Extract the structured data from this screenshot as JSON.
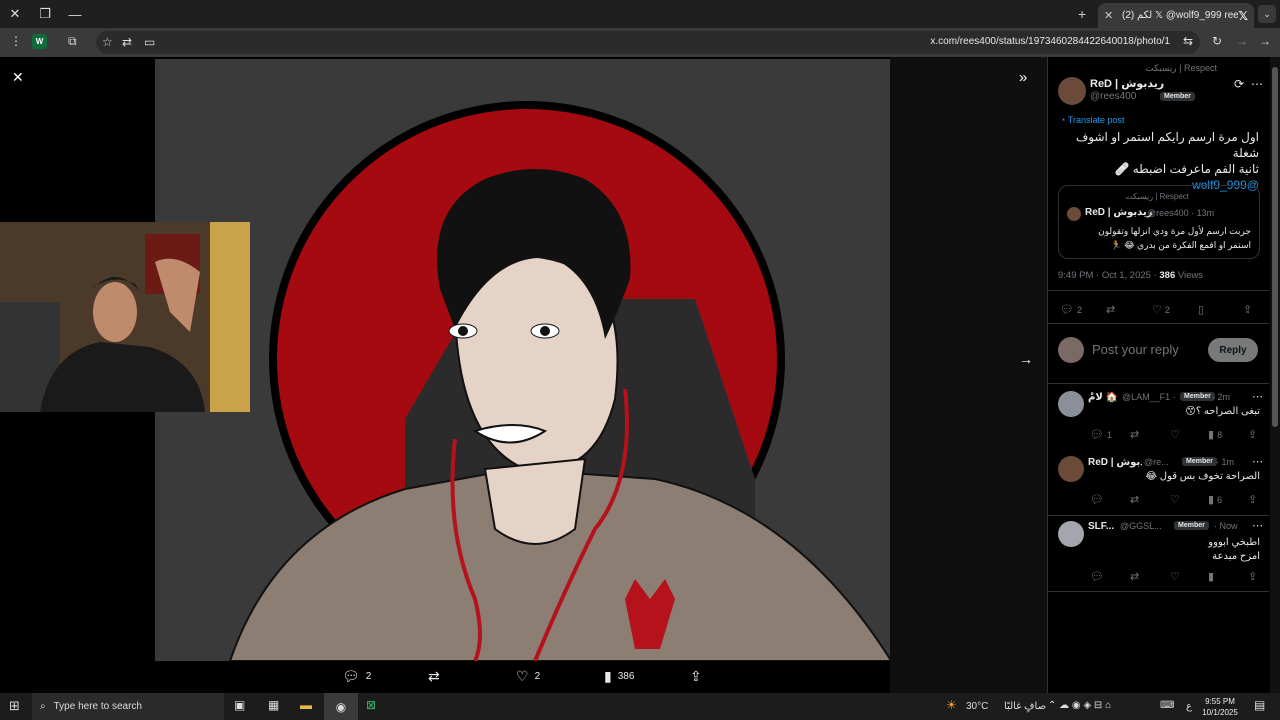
{
  "browser": {
    "tab_title": "(2) لكم 𝕏 @wolf9_999 rees400",
    "url": "x.com/rees400/status/1973460284422640018/photo/1",
    "ext_badge": "W"
  },
  "viewer": {
    "actions": {
      "replies": "2",
      "likes": "2",
      "views": "386"
    }
  },
  "post": {
    "community": "ريسبكت | Respect",
    "author_name": "ReD | ريدبوش",
    "handle": "@rees400",
    "member_badge": "Member",
    "translate": "Translate post",
    "text_line1": "اول مرة ارسم رايكم استمر او اشوف شغلة",
    "text_line2": "ثانية الفم ماعرفت اضبطه 🩹",
    "mention": "@wolf9_999",
    "quote": {
      "community": "ريسبكت | Respect",
      "author": "ReD | ريدبوش",
      "handle": "@rees400 · 13m",
      "line1": "جربت ارسم لأول مرة ودي انزلها وتقولون",
      "line2": "استمر او اقمع الفكرة من بدري 😂 🏃"
    },
    "timestamp": "9:49 PM · Oct 1, 2025 ·",
    "views_count": "386",
    "views_label": "Views",
    "stats": {
      "replies": "2",
      "likes": "2"
    },
    "reply_placeholder": "Post your reply",
    "reply_button": "Reply"
  },
  "replies": [
    {
      "name": "لَامْ 🏠",
      "handle": "@LAM__F1 ·",
      "badge": "Member",
      "time": "· 2m",
      "text": "تبغى الصراحه ؟😙",
      "replies": "1",
      "views": "8"
    },
    {
      "name": "ReD | ريدبوش",
      "handle": "@re...",
      "badge": "Member",
      "time": "· 1m",
      "text": "الصراحة تخوف بس قول 😂",
      "replies": "",
      "views": "6"
    },
    {
      "name": "SLF...",
      "handle": "@GGSL...",
      "badge": "Member",
      "time": "· Now",
      "text": "اطبخي ابووو",
      "text2": "امزح مبدعة",
      "replies": "",
      "views": ""
    }
  ],
  "taskbar": {
    "search_placeholder": "Type here to search",
    "weather_temp": "30°C",
    "weather_desc": "صافٍ غالبًا",
    "lang": "ع",
    "time": "9:55 PM",
    "date": "10/1/2025"
  }
}
